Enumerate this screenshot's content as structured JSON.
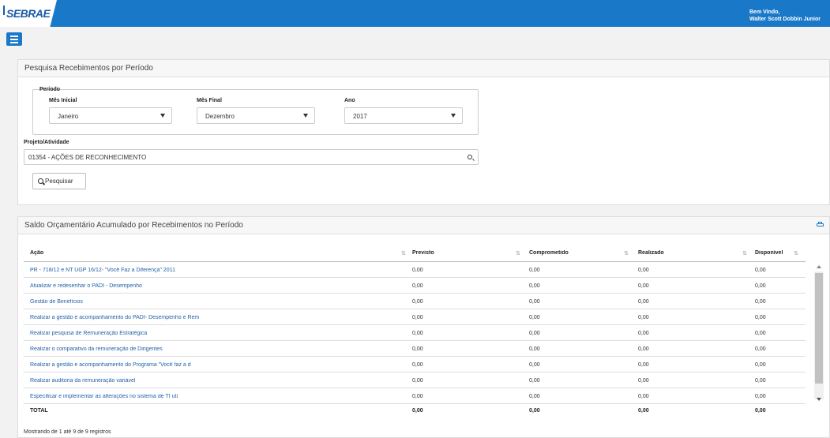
{
  "header": {
    "logo": "SEBRAE",
    "welcome_line1": "Bem Vindo,",
    "welcome_line2": "Walter Scott Dobbin Junior",
    "brand_color": "#1a78c9"
  },
  "search_panel": {
    "title": "Pesquisa Recebimentos por Período",
    "period_legend": "Período",
    "mes_inicial_label": "Mês Inicial",
    "mes_inicial_value": "Janeiro",
    "mes_final_label": "Mês Final",
    "mes_final_value": "Dezembro",
    "ano_label": "Ano",
    "ano_value": "2017",
    "projeto_label": "Projeto/Atividade",
    "projeto_value": "01354 - AÇÕES DE RECONHECIMENTO",
    "search_button": "Pesquisar"
  },
  "results_panel": {
    "title": "Saldo Orçamentário Acumulado por Recebimentos no Período",
    "columns": [
      "Ação",
      "Previsto",
      "Comprometido",
      "Realizado",
      "Disponível"
    ],
    "rows": [
      {
        "acao": "PR - 718/12 e NT UGP 16/12- \"Você Faz a Diferença\" 2011",
        "previsto": "0,00",
        "comprometido": "0,00",
        "realizado": "0,00",
        "disponivel": "0,00"
      },
      {
        "acao": "Atualizar e redesenhar o PADI - Desempenho",
        "previsto": "0,00",
        "comprometido": "0,00",
        "realizado": "0,00",
        "disponivel": "0,00"
      },
      {
        "acao": "Gestão de Benefícios",
        "previsto": "0,00",
        "comprometido": "0,00",
        "realizado": "0,00",
        "disponivel": "0,00"
      },
      {
        "acao": "Realizar a gestão e acompanhamento do PADI- Desempenho e Rem",
        "previsto": "0,00",
        "comprometido": "0,00",
        "realizado": "0,00",
        "disponivel": "0,00"
      },
      {
        "acao": "Realizar pesquisa de Remuneração Estratégica",
        "previsto": "0,00",
        "comprometido": "0,00",
        "realizado": "0,00",
        "disponivel": "0,00"
      },
      {
        "acao": "Realizar o comparativo da remuneração de Dirigentes",
        "previsto": "0,00",
        "comprometido": "0,00",
        "realizado": "0,00",
        "disponivel": "0,00"
      },
      {
        "acao": "Realizar a gestão e acompanhamento do Programa \"Você faz a d",
        "previsto": "0,00",
        "comprometido": "0,00",
        "realizado": "0,00",
        "disponivel": "0,00"
      },
      {
        "acao": "Realizar auditoria da remuneração variável",
        "previsto": "0,00",
        "comprometido": "0,00",
        "realizado": "0,00",
        "disponivel": "0,00"
      },
      {
        "acao": "Especificar e implementar as alterações no sistema de TI uti",
        "previsto": "0,00",
        "comprometido": "0,00",
        "realizado": "0,00",
        "disponivel": "0,00"
      }
    ],
    "total": {
      "label": "TOTAL",
      "previsto": "0,00",
      "comprometido": "0,00",
      "realizado": "0,00",
      "disponivel": "0,00"
    },
    "footer_info": "Mostrando de 1 até 9 de 9 registros"
  }
}
